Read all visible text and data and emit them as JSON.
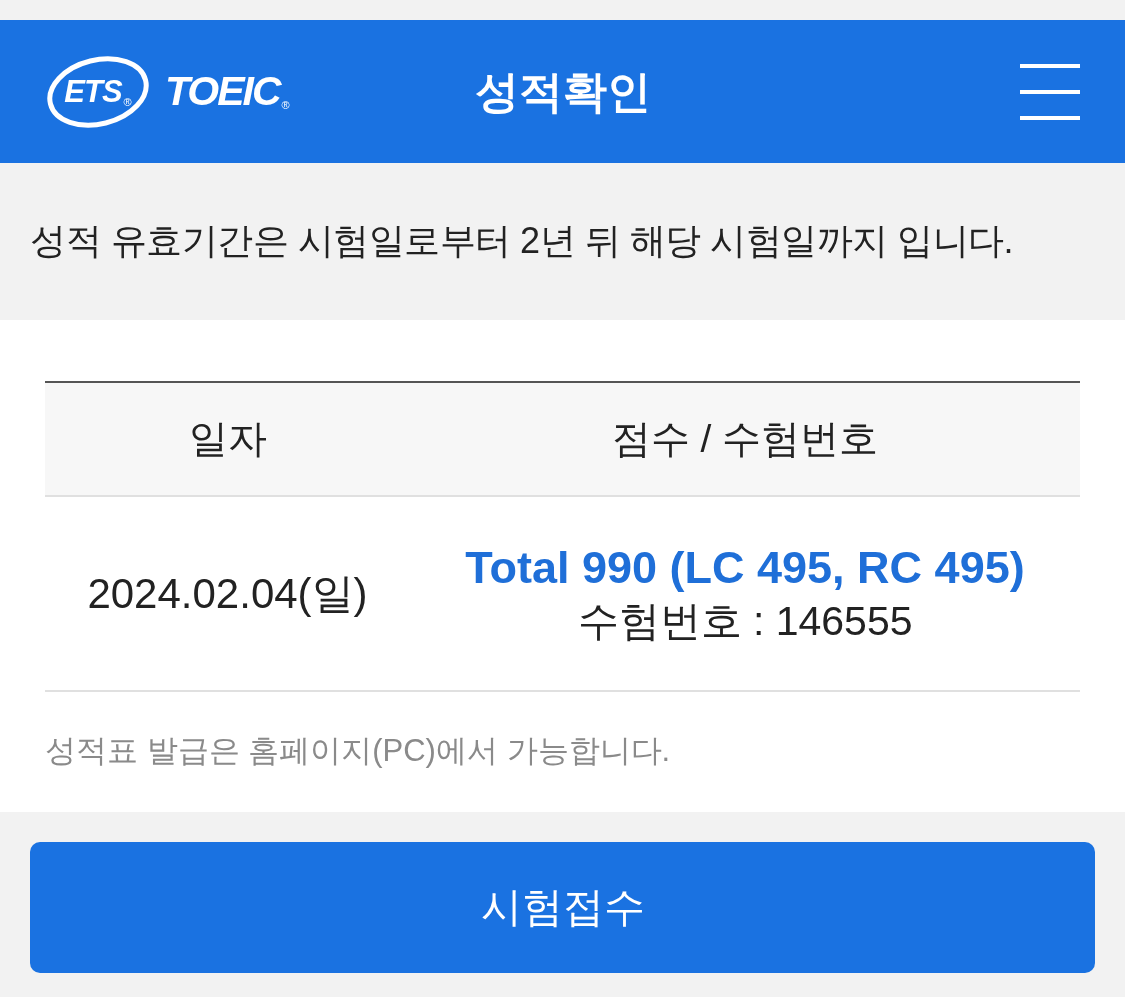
{
  "header": {
    "logo": {
      "brand": "ETS$_{®}$",
      "product": "TOEIC$_{®}$"
    },
    "title": "성적확인"
  },
  "notice": "성적 유효기간은 시험일로부터 2년 뒤 해당 시험일까지 입니다.",
  "score_table": {
    "columns": [
      "일자",
      "점수 / 수험번호"
    ],
    "rows": [
      {
        "date": "2024.02.04(일)",
        "score": "Total 990 (LC 495, RC 495)",
        "registration": "수험번호 : 146555"
      }
    ]
  },
  "footnote": "성적표 발급은 홈페이지(PC)에서 가능합니다.",
  "buttons": [
    {
      "label": "시험접수"
    }
  ]
}
